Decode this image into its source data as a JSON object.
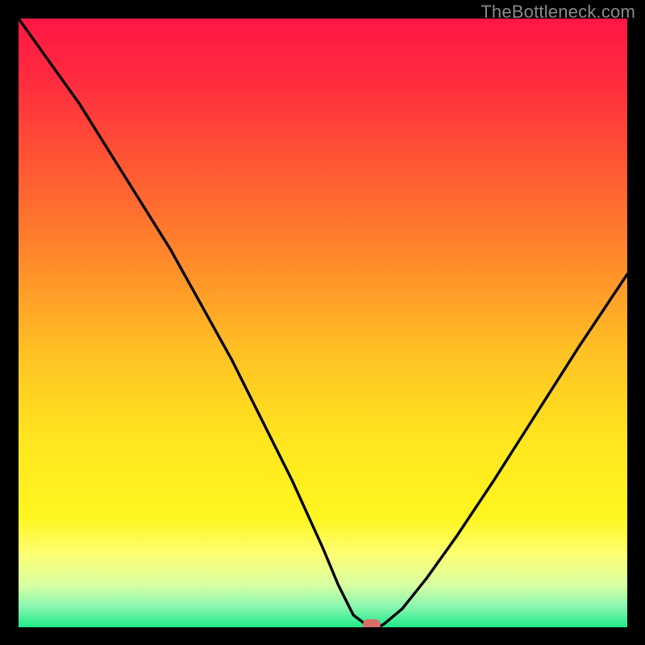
{
  "watermark": "TheBottleneck.com",
  "chart_data": {
    "type": "line",
    "title": "",
    "xlabel": "",
    "ylabel": "",
    "xlim": [
      0,
      100
    ],
    "ylim": [
      0,
      100
    ],
    "grid": false,
    "legend": false,
    "series": [
      {
        "name": "bottleneck-curve",
        "x": [
          0,
          5,
          10,
          15,
          20,
          25,
          30,
          35,
          40,
          45,
          50,
          52.5,
          55,
          57,
          58,
          59,
          60,
          63,
          67,
          72,
          78,
          85,
          92,
          100
        ],
        "y": [
          100,
          93,
          86,
          78,
          70,
          62,
          53,
          44,
          34,
          24,
          13,
          7,
          2,
          0.5,
          0,
          0,
          0.5,
          3,
          8,
          15,
          24,
          35,
          46,
          58
        ]
      }
    ],
    "optimal_point": {
      "x": 58,
      "y": 0
    },
    "background_gradient": {
      "stops": [
        {
          "offset": 0.0,
          "color": "#ff1744"
        },
        {
          "offset": 0.1,
          "color": "#ff2b3f"
        },
        {
          "offset": 0.25,
          "color": "#ff5a33"
        },
        {
          "offset": 0.4,
          "color": "#ff8b2a"
        },
        {
          "offset": 0.55,
          "color": "#ffc224"
        },
        {
          "offset": 0.7,
          "color": "#ffe71f"
        },
        {
          "offset": 0.82,
          "color": "#fff61f"
        },
        {
          "offset": 0.88,
          "color": "#fdff74"
        },
        {
          "offset": 0.93,
          "color": "#d9ffa2"
        },
        {
          "offset": 0.965,
          "color": "#8cf7b0"
        },
        {
          "offset": 1.0,
          "color": "#1fe98a"
        }
      ]
    }
  }
}
